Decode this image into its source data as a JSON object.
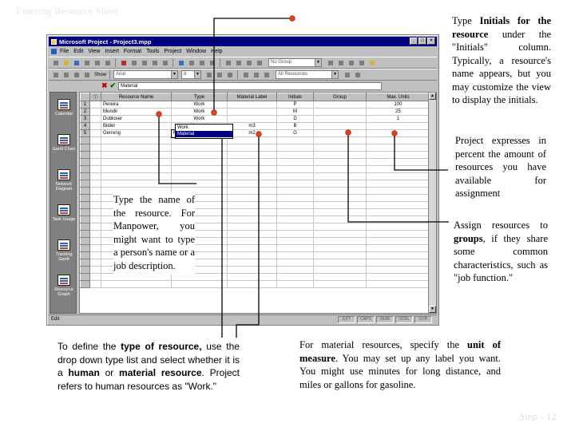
{
  "slide": {
    "title": "Entering Resource Sheet",
    "footer": "Step - 12"
  },
  "window": {
    "title": "Microsoft Project - Project3.mpp",
    "menu": [
      "File",
      "Edit",
      "View",
      "Insert",
      "Format",
      "Tools",
      "Project",
      "Window",
      "Help"
    ],
    "toolbar1": {
      "group_combo": "No Group"
    },
    "toolbar2": {
      "font_combo": "Arial",
      "size_combo": "8",
      "filter_combo": "All Resources"
    },
    "toolbar3": {
      "show_label": "Show"
    },
    "entry_value": "Material"
  },
  "viewbar": {
    "items": [
      "Calendar",
      "Gantt Chart",
      "Network Diagram",
      "Task Usage",
      "Tracking Gantt",
      "Resource Graph"
    ]
  },
  "sheet": {
    "columns": [
      "",
      "",
      "Resource Name",
      "Type",
      "Material Label",
      "Initials",
      "Group",
      "Max. Units"
    ],
    "rows": [
      {
        "id": "1",
        "name": "Pereira",
        "type": "Work",
        "label": "",
        "initials": "P",
        "group": "",
        "max": "100"
      },
      {
        "id": "2",
        "name": "Mundir",
        "type": "Work",
        "label": "",
        "initials": "M",
        "group": "",
        "max": "25"
      },
      {
        "id": "3",
        "name": "Dubloser",
        "type": "Work",
        "label": "",
        "initials": "D",
        "group": "",
        "max": "1"
      },
      {
        "id": "4",
        "name": "Bilder",
        "type": "Material",
        "label": "m3",
        "initials": "B",
        "group": "",
        "max": ""
      },
      {
        "id": "5",
        "name": "Gerreng",
        "type": "Material",
        "label": "m2",
        "initials": "G",
        "group": "",
        "max": ""
      }
    ],
    "dropdown_options": [
      "Work",
      "Material"
    ],
    "dropdown_selected": "Material"
  },
  "statusbar": {
    "mode": "Edit",
    "slots": [
      "EXT",
      "CAPS",
      "NUM",
      "SCRL",
      "OVR"
    ]
  },
  "notes": {
    "initials": {
      "p1": "Type ",
      "b1": "Initials for the resource",
      "p2": " under the \"Initials\" column. Typically, a resource's name appears, but you may customize the view to display the initials."
    },
    "percent": "Project expresses in percent the amount of resources you have available for assignment",
    "name": "Type the name of the resource. For Manpower, you might want to type a person's name or a job description.",
    "groups": {
      "p1": "Assign resources to ",
      "b1": "groups",
      "p2": ", if they share some common characteristics, such as \"job function.\""
    },
    "type": {
      "p1": "To define the ",
      "b1": "type of resource,",
      "p2": " use the drop down type list and select whether it is a ",
      "b2": "human",
      "p3": " or ",
      "b3": "material resource",
      "p4": ". Project refers to human resources as \"Work.\""
    },
    "material": {
      "p1": "For material resources, specify the ",
      "b1": "unit of measure",
      "p2": ". You may set up any label you want. You might use minutes for long distance, and miles or gallons for gasoline."
    }
  },
  "colors": {
    "connector": "#000000",
    "dot": "#e0441c",
    "titlebar": "#000080"
  }
}
